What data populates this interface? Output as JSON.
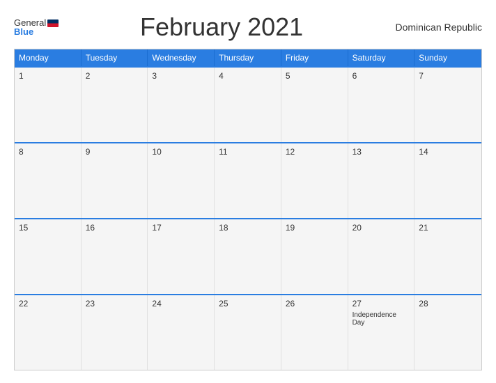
{
  "header": {
    "logo_general": "General",
    "logo_blue": "Blue",
    "month_title": "February 2021",
    "country": "Dominican Republic"
  },
  "day_headers": [
    "Monday",
    "Tuesday",
    "Wednesday",
    "Thursday",
    "Friday",
    "Saturday",
    "Sunday"
  ],
  "weeks": [
    {
      "days": [
        {
          "number": "1",
          "events": []
        },
        {
          "number": "2",
          "events": []
        },
        {
          "number": "3",
          "events": []
        },
        {
          "number": "4",
          "events": []
        },
        {
          "number": "5",
          "events": []
        },
        {
          "number": "6",
          "events": []
        },
        {
          "number": "7",
          "events": []
        }
      ]
    },
    {
      "days": [
        {
          "number": "8",
          "events": []
        },
        {
          "number": "9",
          "events": []
        },
        {
          "number": "10",
          "events": []
        },
        {
          "number": "11",
          "events": []
        },
        {
          "number": "12",
          "events": []
        },
        {
          "number": "13",
          "events": []
        },
        {
          "number": "14",
          "events": []
        }
      ]
    },
    {
      "days": [
        {
          "number": "15",
          "events": []
        },
        {
          "number": "16",
          "events": []
        },
        {
          "number": "17",
          "events": []
        },
        {
          "number": "18",
          "events": []
        },
        {
          "number": "19",
          "events": []
        },
        {
          "number": "20",
          "events": []
        },
        {
          "number": "21",
          "events": []
        }
      ]
    },
    {
      "days": [
        {
          "number": "22",
          "events": []
        },
        {
          "number": "23",
          "events": []
        },
        {
          "number": "24",
          "events": []
        },
        {
          "number": "25",
          "events": []
        },
        {
          "number": "26",
          "events": []
        },
        {
          "number": "27",
          "events": [
            "Independence Day"
          ]
        },
        {
          "number": "28",
          "events": []
        }
      ]
    }
  ]
}
